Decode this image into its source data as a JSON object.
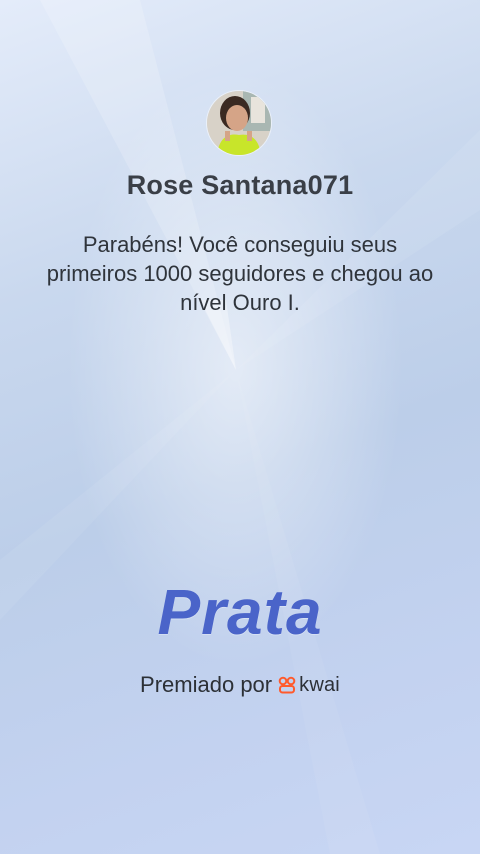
{
  "profile": {
    "username": "Rose Santana071",
    "avatar_icon": "user-photo-avatar"
  },
  "message": {
    "text": "Parabéns! Você conseguiu seus primeiros 1000 seguidores e chegou ao nível Ouro I."
  },
  "level": {
    "title": "Prata",
    "color": "#4a64c9"
  },
  "footer": {
    "awarded_label": "Premiado por",
    "brand_text": "kwai",
    "brand_icon": "kwai-logo-icon",
    "brand_color": "#ff5a2c"
  }
}
